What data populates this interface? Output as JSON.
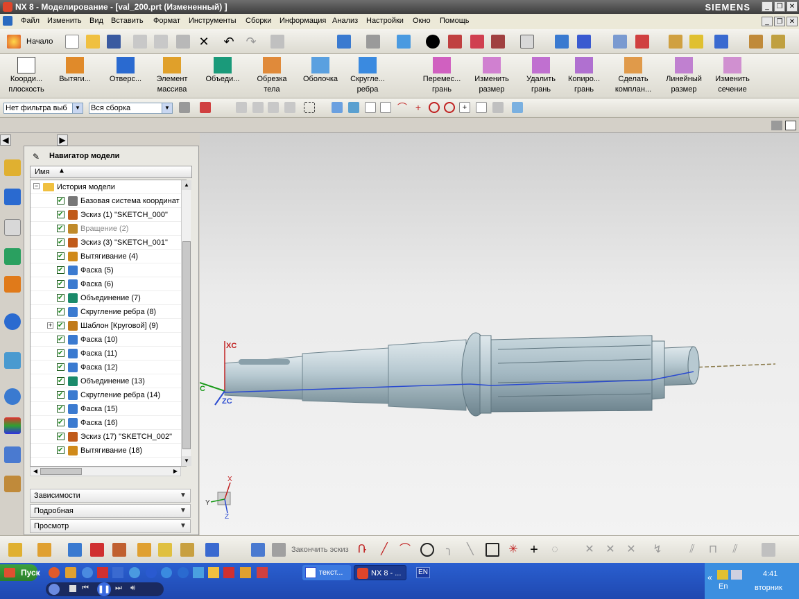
{
  "window": {
    "title": "NX 8 - Моделирование - [val_200.prt (Измененный) ]",
    "brand": "SIEMENS",
    "min": "_",
    "restore": "❐",
    "close": "✕"
  },
  "menu": [
    "Файл",
    "Изменить",
    "Вид",
    "Вставить",
    "Формат",
    "Инструменты",
    "Сборки",
    "Информация",
    "Анализ",
    "Настройки",
    "Окно",
    "Помощь"
  ],
  "std_toolbar": {
    "start_label": "Начало"
  },
  "ribbon": [
    {
      "l1": "Коорди...",
      "l2": "плоскость"
    },
    {
      "l1": "Вытяги...",
      "l2": ""
    },
    {
      "l1": "Отверс...",
      "l2": ""
    },
    {
      "l1": "Элемент",
      "l2": "массива"
    },
    {
      "l1": "Объеди...",
      "l2": ""
    },
    {
      "l1": "Обрезка",
      "l2": "тела"
    },
    {
      "l1": "Оболочка",
      "l2": ""
    },
    {
      "l1": "Скругле...",
      "l2": "ребра"
    },
    {
      "l1": "Перемес...",
      "l2": "грань"
    },
    {
      "l1": "Изменить",
      "l2": "размер"
    },
    {
      "l1": "Удалить",
      "l2": "грань"
    },
    {
      "l1": "Копиро...",
      "l2": "грань"
    },
    {
      "l1": "Сделать",
      "l2": "комплан..."
    },
    {
      "l1": "Линейный",
      "l2": "размер"
    },
    {
      "l1": "Изменить",
      "l2": "сечение"
    }
  ],
  "filters": {
    "type_filter": "Нет фильтра выб",
    "scope": "Вся сборка"
  },
  "navigator": {
    "title": "Навигатор модели",
    "col_name": "Имя",
    "root": "История модели",
    "items": [
      {
        "label": "Базовая система координат",
        "color": "#777777"
      },
      {
        "label": "Эскиз (1) \"SKETCH_000\"",
        "color": "#c05a1a"
      },
      {
        "label": "Вращение (2)",
        "color": "#c08a2a",
        "dim": true
      },
      {
        "label": "Эскиз (3) \"SKETCH_001\"",
        "color": "#c05a1a"
      },
      {
        "label": "Вытягивание (4)",
        "color": "#d08a1a"
      },
      {
        "label": "Фаска (5)",
        "color": "#3a7ad0"
      },
      {
        "label": "Фаска (6)",
        "color": "#3a7ad0"
      },
      {
        "label": "Объединение (7)",
        "color": "#1a8a6a"
      },
      {
        "label": "Скругление ребра (8)",
        "color": "#3a7ad0"
      },
      {
        "label": "Шаблон [Круговой] (9)",
        "color": "#c07a1a"
      },
      {
        "label": "Фаска (10)",
        "color": "#3a7ad0"
      },
      {
        "label": "Фаска (11)",
        "color": "#3a7ad0"
      },
      {
        "label": "Фаска (12)",
        "color": "#3a7ad0"
      },
      {
        "label": "Объединение (13)",
        "color": "#1a8a6a"
      },
      {
        "label": "Скругление ребра (14)",
        "color": "#3a7ad0"
      },
      {
        "label": "Фаска (15)",
        "color": "#3a7ad0"
      },
      {
        "label": "Фаска (16)",
        "color": "#3a7ad0"
      },
      {
        "label": "Эскиз (17) \"SKETCH_002\"",
        "color": "#c05a1a"
      },
      {
        "label": "Вытягивание (18)",
        "color": "#d08a1a"
      }
    ],
    "panels": [
      "Зависимости",
      "Подробная",
      "Просмотр"
    ]
  },
  "viewport": {
    "axis_xc": "XC",
    "axis_zc": "ZC",
    "axis_c": "C",
    "triad_x": "X",
    "triad_y": "Y",
    "triad_z": "Z"
  },
  "bottom_toolbar": {
    "finish_sketch": "Закончить эскиз"
  },
  "taskbar": {
    "start": "Пуск",
    "tasks": [
      "текст...",
      "NX 8 - ..."
    ],
    "lang": "EN",
    "time": "4:41",
    "day": "вторник",
    "tray_lang": "En"
  }
}
